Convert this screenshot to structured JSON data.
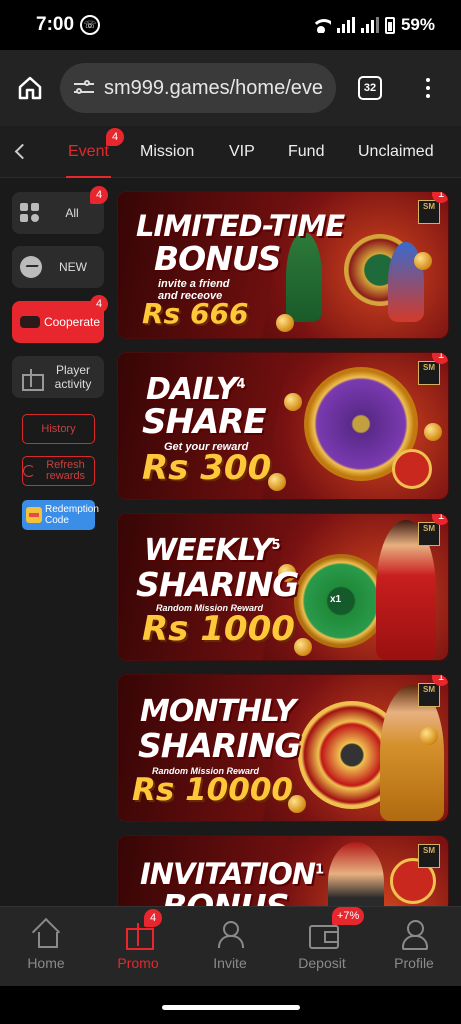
{
  "status_bar": {
    "time": "7:00",
    "battery": "59%"
  },
  "browser": {
    "url": "sm999.games/home/eve",
    "tab_count": "32"
  },
  "tabs": [
    {
      "label": "Event",
      "badge": "4",
      "active": true
    },
    {
      "label": "Mission"
    },
    {
      "label": "VIP"
    },
    {
      "label": "Fund"
    },
    {
      "label": "Unclaimed"
    }
  ],
  "sidebar": {
    "items": [
      {
        "label": "All",
        "badge": "4"
      },
      {
        "label": "NEW"
      },
      {
        "label": "Cooperate",
        "badge": "4",
        "active": true
      },
      {
        "label": "Player activity"
      }
    ],
    "history_label": "History",
    "refresh_label": "Refresh rewards",
    "redeem_label": "Redemption Code"
  },
  "banners": [
    {
      "title_line1": "LIMITED-TIME",
      "title_line2": "BONUS",
      "subtitle_line1": "invite a friend",
      "subtitle_line2": "and receove",
      "amount": "Rs 666",
      "badge": "1",
      "logo": "SM"
    },
    {
      "title_line1": "DAILY",
      "title_mark": "4",
      "title_line2": "SHARE",
      "subtitle": "Get your reward",
      "amount": "Rs 300",
      "badge": "1",
      "logo": "SM"
    },
    {
      "title_line1": "WEEKLY",
      "title_mark": "5",
      "title_line2": "SHARING",
      "subtitle": "Random Mission Reward",
      "amount": "Rs 1000",
      "badge": "1",
      "logo": "SM",
      "wheel_center": "x1"
    },
    {
      "title_line1": "MONTHLY",
      "title_line2": "SHARING",
      "subtitle": "Random Mission Reward",
      "amount": "Rs 10000",
      "badge": "1",
      "logo": "SM"
    },
    {
      "title_line1": "INVITATION",
      "title_mark": "1",
      "title_line2": "BONUS",
      "logo": "SM"
    }
  ],
  "bottom_nav": [
    {
      "label": "Home",
      "icon": "home-icon"
    },
    {
      "label": "Promo",
      "icon": "gift-icon",
      "badge": "4",
      "active": true
    },
    {
      "label": "Invite",
      "icon": "invite-icon"
    },
    {
      "label": "Deposit",
      "icon": "wallet-icon",
      "badge": "+7%"
    },
    {
      "label": "Profile",
      "icon": "profile-icon"
    }
  ],
  "colors": {
    "accent": "#e8262e",
    "background": "#1a1a1a",
    "gold": "#ffc83a"
  }
}
